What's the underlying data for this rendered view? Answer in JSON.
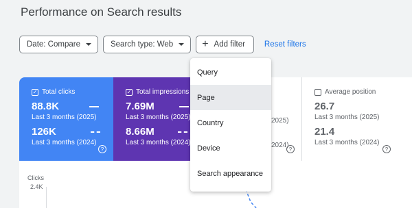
{
  "page": {
    "title": "Performance on Search results"
  },
  "filters": {
    "date_label": "Date: Compare",
    "search_type_label": "Search type: Web",
    "add_filter_label": "Add filter",
    "reset_label": "Reset filters"
  },
  "metrics": {
    "clicks": {
      "label": "Total clicks",
      "checked": true,
      "current_value": "88.8K",
      "current_period": "Last 3 months (2025)",
      "previous_value": "126K",
      "previous_period": "Last 3 months (2024)",
      "color": "#4285f4"
    },
    "impressions": {
      "label": "Total impressions",
      "checked": true,
      "current_value": "7.69M",
      "current_period": "Last 3 months (2025)",
      "previous_value": "8.66M",
      "previous_period": "Last 3 months (2024)",
      "color": "#5e35b1"
    },
    "ctr": {
      "current_period_partial": "2025)",
      "previous_period_partial": "2024)"
    },
    "position": {
      "label": "Average position",
      "checked": false,
      "current_value": "26.7",
      "current_period": "Last 3 months (2025)",
      "previous_value": "21.4",
      "previous_period": "Last 3 months (2024)"
    }
  },
  "chart": {
    "ylabel": "Clicks",
    "top_tick": "2.4K"
  },
  "dropdown": {
    "items": [
      "Query",
      "Page",
      "Country",
      "Device",
      "Search appearance"
    ],
    "hovered": "Page"
  }
}
